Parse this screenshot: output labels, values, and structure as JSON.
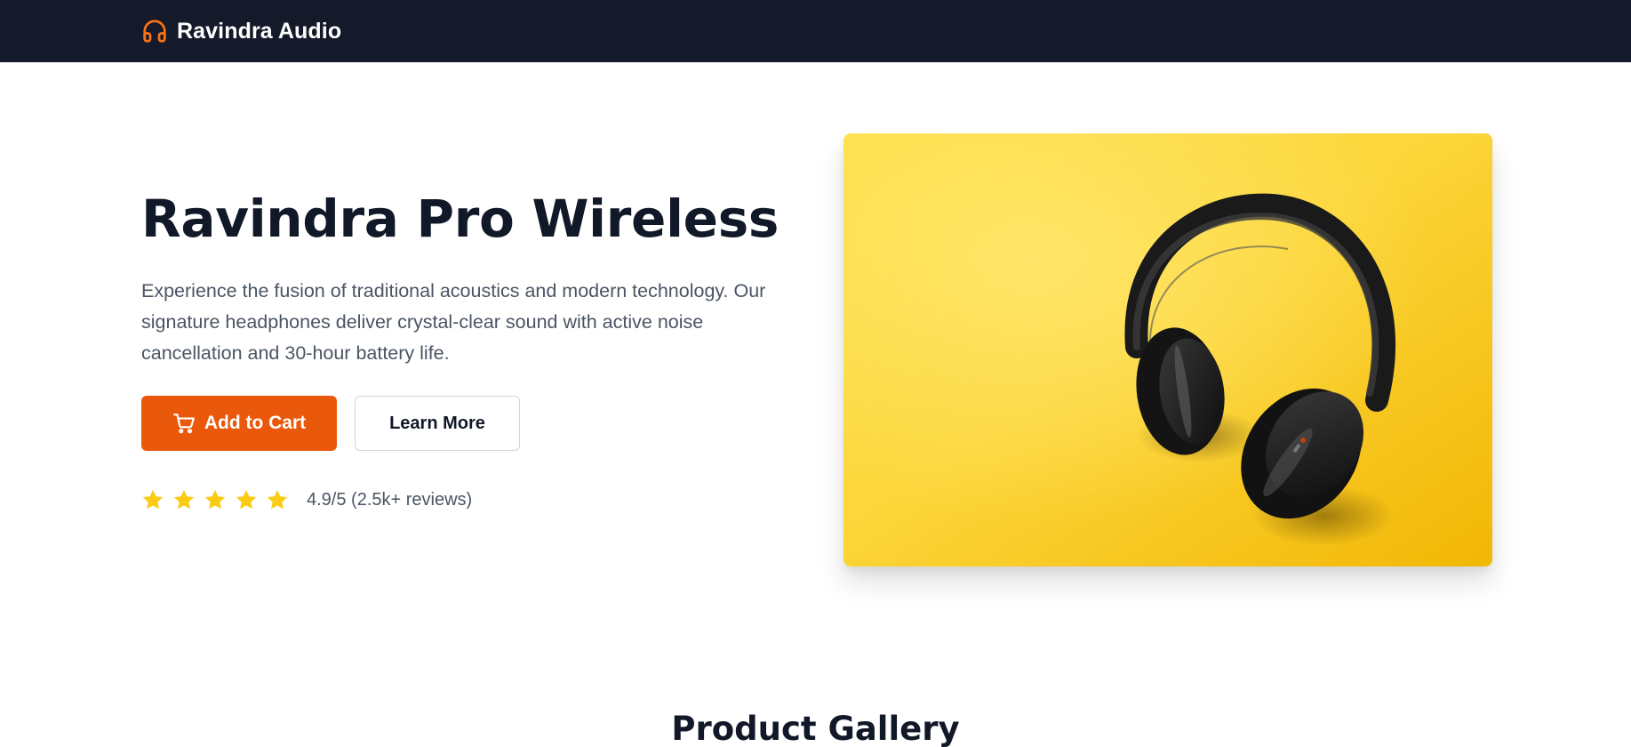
{
  "navbar": {
    "brand_name": "Ravindra Audio",
    "brand_icon": "headphones-icon",
    "background": "#141a29",
    "icon_color": "#f97316"
  },
  "hero": {
    "title": "Ravindra Pro Wireless",
    "description": "Experience the fusion of traditional acoustics and modern technology. Our signature headphones deliver crystal-clear sound with active noise cancellation and 30-hour battery life.",
    "add_to_cart_label": "Add to Cart",
    "add_to_cart_icon": "cart-icon",
    "learn_more_label": "Learn More",
    "accent_color": "#ea580c",
    "rating": {
      "stars": 5,
      "star_color": "#facc15",
      "text": "4.9/5 (2.5k+ reviews)"
    },
    "image": {
      "subject": "black over-ear headphones on yellow background",
      "background_color": "#facc15"
    }
  },
  "gallery": {
    "title": "Product Gallery"
  }
}
